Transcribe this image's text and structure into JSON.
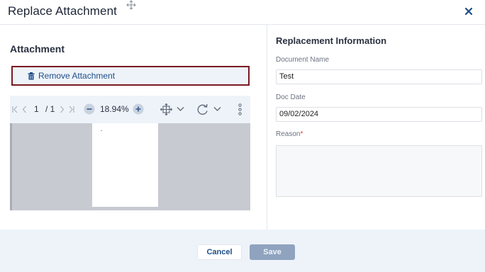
{
  "header": {
    "title": "Replace Attachment"
  },
  "left": {
    "section_title": "Attachment",
    "remove_label": "Remove Attachment"
  },
  "viewer": {
    "current_page": "1",
    "total_pages": "/ 1",
    "zoom": "18.94%"
  },
  "right": {
    "title": "Replacement Information",
    "doc_name_label": "Document Name",
    "doc_name_value": "Test",
    "doc_date_label": "Doc Date",
    "doc_date_value": "09/02/2024",
    "reason_label": "Reason",
    "reason_required": "*",
    "reason_value": ""
  },
  "footer": {
    "cancel_label": "Cancel",
    "save_label": "Save"
  },
  "colors": {
    "accent": "#1e4e87",
    "remove_border": "#7a1a22",
    "required": "#d23b3b",
    "save_disabled": "#8fa3bf"
  }
}
